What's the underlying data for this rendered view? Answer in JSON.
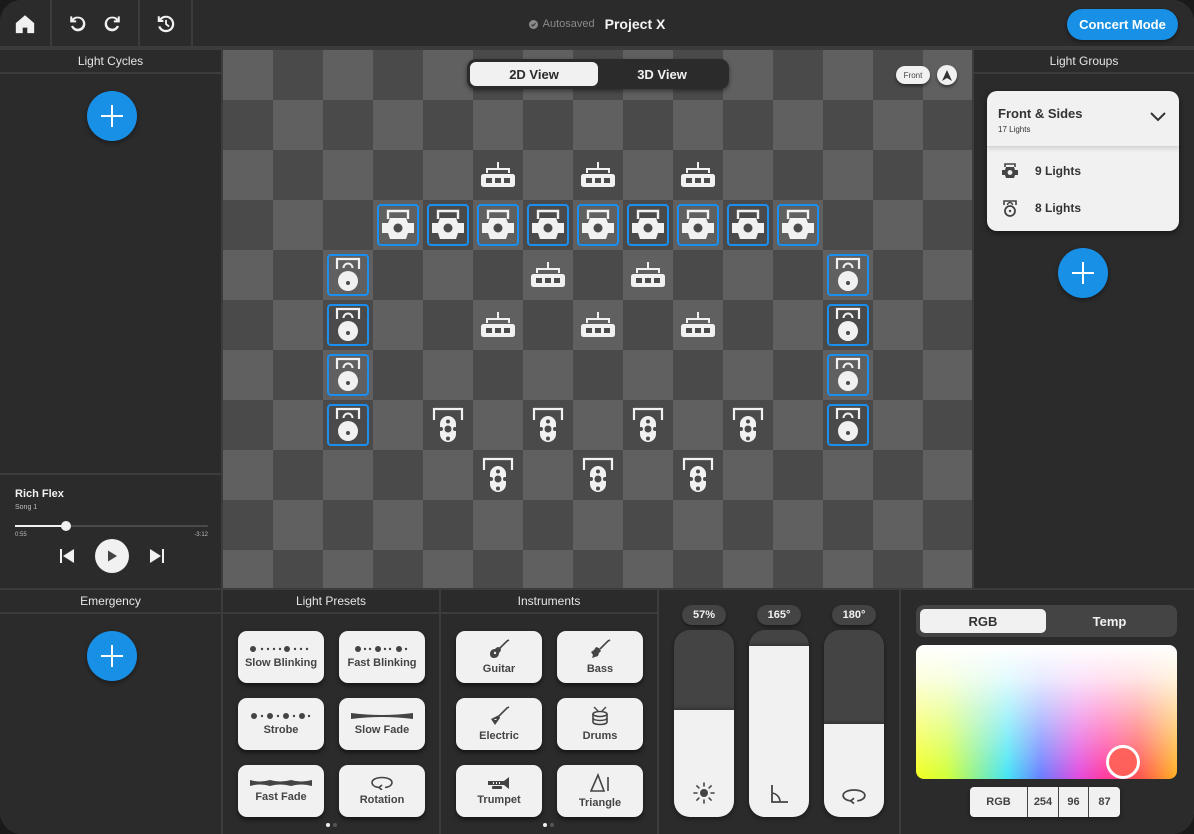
{
  "topbar": {
    "autosave_status": "Autosaved",
    "project_title": "Project X",
    "concert_mode_label": "Concert Mode",
    "buttons": [
      "home-icon",
      "undo-icon",
      "redo-icon",
      "history-icon"
    ]
  },
  "light_cycles": {
    "title": "Light Cycles"
  },
  "player": {
    "song_title": "Rich Flex",
    "song_subtitle": "Song 1",
    "elapsed": "0:55",
    "remaining": "-3:12",
    "progress": 0.265
  },
  "stage": {
    "view_toggle": {
      "options": [
        "2D View",
        "3D View"
      ],
      "active": "2D View"
    },
    "orientation_label": "Front",
    "cols": 15,
    "rows": 11,
    "fixtures": [
      {
        "type": "bar",
        "col": 5,
        "row": 2
      },
      {
        "type": "bar",
        "col": 7,
        "row": 2
      },
      {
        "type": "bar",
        "col": 9,
        "row": 2
      },
      {
        "type": "spot",
        "col": 3,
        "row": 3,
        "selected": true
      },
      {
        "type": "spot",
        "col": 4,
        "row": 3,
        "selected": true
      },
      {
        "type": "spot",
        "col": 5,
        "row": 3,
        "selected": true
      },
      {
        "type": "spot",
        "col": 6,
        "row": 3,
        "selected": true
      },
      {
        "type": "spot",
        "col": 7,
        "row": 3,
        "selected": true
      },
      {
        "type": "spot",
        "col": 8,
        "row": 3,
        "selected": true
      },
      {
        "type": "spot",
        "col": 9,
        "row": 3,
        "selected": true
      },
      {
        "type": "spot",
        "col": 10,
        "row": 3,
        "selected": true
      },
      {
        "type": "spot",
        "col": 11,
        "row": 3,
        "selected": true
      },
      {
        "type": "par",
        "col": 2,
        "row": 4,
        "selected": true
      },
      {
        "type": "bar",
        "col": 6,
        "row": 4
      },
      {
        "type": "bar",
        "col": 8,
        "row": 4
      },
      {
        "type": "par",
        "col": 12,
        "row": 4,
        "selected": true
      },
      {
        "type": "par",
        "col": 2,
        "row": 5,
        "selected": true
      },
      {
        "type": "bar",
        "col": 5,
        "row": 5
      },
      {
        "type": "bar",
        "col": 7,
        "row": 5
      },
      {
        "type": "bar",
        "col": 9,
        "row": 5
      },
      {
        "type": "par",
        "col": 12,
        "row": 5,
        "selected": true
      },
      {
        "type": "par",
        "col": 2,
        "row": 6,
        "selected": true
      },
      {
        "type": "par",
        "col": 12,
        "row": 6,
        "selected": true
      },
      {
        "type": "par",
        "col": 2,
        "row": 7,
        "selected": true
      },
      {
        "type": "wash",
        "col": 4,
        "row": 7
      },
      {
        "type": "wash",
        "col": 6,
        "row": 7
      },
      {
        "type": "wash",
        "col": 8,
        "row": 7
      },
      {
        "type": "wash",
        "col": 10,
        "row": 7
      },
      {
        "type": "par",
        "col": 12,
        "row": 7,
        "selected": true
      },
      {
        "type": "wash",
        "col": 5,
        "row": 8
      },
      {
        "type": "wash",
        "col": 7,
        "row": 8
      },
      {
        "type": "wash",
        "col": 9,
        "row": 8
      }
    ]
  },
  "light_groups": {
    "title": "Light Groups",
    "group": {
      "name": "Front & Sides",
      "count_label": "17 Lights",
      "rows": [
        {
          "icon": "spot-light-icon",
          "label": "9 Lights"
        },
        {
          "icon": "par-light-icon",
          "label": "8 Lights"
        }
      ]
    }
  },
  "emergency": {
    "title": "Emergency"
  },
  "light_presets": {
    "title": "Light Presets",
    "items": [
      {
        "label": "Slow Blinking",
        "icon": "slow-blink-icon"
      },
      {
        "label": "Fast Blinking",
        "icon": "fast-blink-icon"
      },
      {
        "label": "Strobe",
        "icon": "strobe-icon"
      },
      {
        "label": "Slow Fade",
        "icon": "slow-fade-icon"
      },
      {
        "label": "Fast Fade",
        "icon": "fast-fade-icon"
      },
      {
        "label": "Rotation",
        "icon": "rotation-icon"
      }
    ],
    "page": 1,
    "pages": 2
  },
  "instruments": {
    "title": "Instruments",
    "items": [
      {
        "label": "Guitar",
        "icon": "guitar-icon"
      },
      {
        "label": "Bass",
        "icon": "bass-icon"
      },
      {
        "label": "Electric",
        "icon": "electric-guitar-icon"
      },
      {
        "label": "Drums",
        "icon": "drums-icon"
      },
      {
        "label": "Trumpet",
        "icon": "trumpet-icon"
      },
      {
        "label": "Triangle",
        "icon": "triangle-icon"
      }
    ],
    "page": 1,
    "pages": 2
  },
  "sliders": [
    {
      "name": "brightness",
      "label": "57%",
      "fill": 0.57,
      "icon": "brightness-icon"
    },
    {
      "name": "tilt",
      "label": "165°",
      "fill": 0.917,
      "icon": "angle-icon"
    },
    {
      "name": "rotation",
      "label": "180°",
      "fill": 0.5,
      "icon": "rotation-icon"
    }
  ],
  "color": {
    "modes": [
      "RGB",
      "Temp"
    ],
    "active_mode": "RGB",
    "readout": {
      "label": "RGB",
      "r": "254",
      "g": "96",
      "b": "87"
    },
    "selected_hex": "#fe6057"
  },
  "colors": {
    "accent": "#1890e6",
    "selection": "#1a8ff0",
    "panel": "#2b2b2b",
    "cell_light": "#606060",
    "cell_dark": "#4a4a4a"
  }
}
